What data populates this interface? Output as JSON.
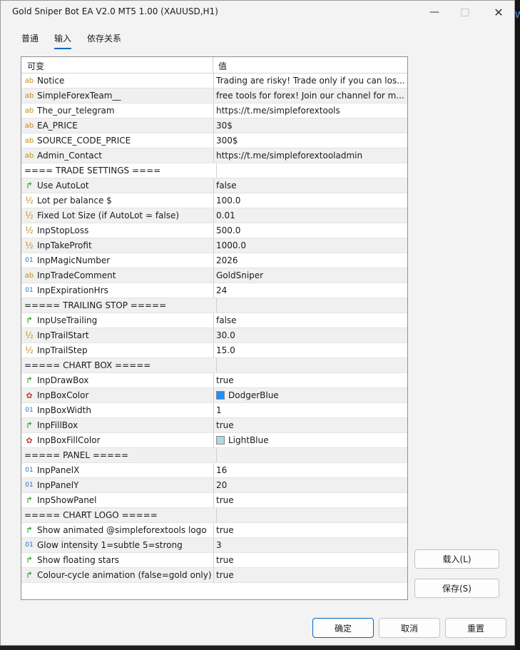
{
  "window": {
    "title": "Gold Sniper Bot EA V2.0 MT5 1.00 (XAUUSD,H1)",
    "minimize_icon": "minimize-icon",
    "maximize_icon": "maximize-icon",
    "close_icon": "close-icon"
  },
  "tabs": [
    {
      "label": "普通"
    },
    {
      "label": "输入",
      "active": true
    },
    {
      "label": "依存关系"
    }
  ],
  "grid": {
    "col_variable": "可变",
    "col_value": "值",
    "rows": [
      {
        "type": "string",
        "icon": "ab",
        "name": "Notice",
        "value": "Trading are risky! Trade only if you can los..."
      },
      {
        "type": "string",
        "icon": "ab",
        "name": "SimpleForexTeam__",
        "value": "free tools for forex! Join our channel for m..."
      },
      {
        "type": "string",
        "icon": "ab",
        "name": "The_our_telegram",
        "value": "https://t.me/simpleforextools"
      },
      {
        "type": "string",
        "icon": "ab",
        "name": "EA_PRICE",
        "value": "30$"
      },
      {
        "type": "string",
        "icon": "ab",
        "name": "SOURCE_CODE_PRICE",
        "value": "300$"
      },
      {
        "type": "string",
        "icon": "ab",
        "name": "Admin_Contact",
        "value": "https://t.me/simpleforextooladmin"
      },
      {
        "type": "separator",
        "name": "====  TRADE SETTINGS  ====",
        "value": ""
      },
      {
        "type": "bool",
        "icon": "↱",
        "name": "Use AutoLot",
        "value": "false"
      },
      {
        "type": "double",
        "icon": "½",
        "name": "Lot per balance $",
        "value": "100.0"
      },
      {
        "type": "double",
        "icon": "½",
        "name": "Fixed Lot Size (if AutoLot = false)",
        "value": "0.01"
      },
      {
        "type": "double",
        "icon": "½",
        "name": "InpStopLoss",
        "value": "500.0"
      },
      {
        "type": "double",
        "icon": "½",
        "name": "InpTakeProfit",
        "value": "1000.0"
      },
      {
        "type": "int",
        "icon": "01",
        "name": "InpMagicNumber",
        "value": "2026"
      },
      {
        "type": "string",
        "icon": "ab",
        "name": "InpTradeComment",
        "value": "GoldSniper"
      },
      {
        "type": "int",
        "icon": "01",
        "name": "InpExpirationHrs",
        "value": "24"
      },
      {
        "type": "separator",
        "name": "=====  TRAILING STOP  =====",
        "value": ""
      },
      {
        "type": "bool",
        "icon": "↱",
        "name": "InpUseTrailing",
        "value": "false"
      },
      {
        "type": "double",
        "icon": "½",
        "name": "InpTrailStart",
        "value": "30.0"
      },
      {
        "type": "double",
        "icon": "½",
        "name": "InpTrailStep",
        "value": "15.0"
      },
      {
        "type": "separator",
        "name": "=====  CHART BOX  =====",
        "value": ""
      },
      {
        "type": "bool",
        "icon": "↱",
        "name": "InpDrawBox",
        "value": "true"
      },
      {
        "type": "color",
        "icon": "✿",
        "name": "InpBoxColor",
        "value": "DodgerBlue",
        "swatch": "#1e90ff"
      },
      {
        "type": "int",
        "icon": "01",
        "name": "InpBoxWidth",
        "value": "1"
      },
      {
        "type": "bool",
        "icon": "↱",
        "name": "InpFillBox",
        "value": "true"
      },
      {
        "type": "color",
        "icon": "✿",
        "name": "InpBoxFillColor",
        "value": "LightBlue",
        "swatch": "#add8e6"
      },
      {
        "type": "separator",
        "name": "=====  PANEL  =====",
        "value": ""
      },
      {
        "type": "int",
        "icon": "01",
        "name": "InpPanelX",
        "value": "16"
      },
      {
        "type": "int",
        "icon": "01",
        "name": "InpPanelY",
        "value": "20"
      },
      {
        "type": "bool",
        "icon": "↱",
        "name": "InpShowPanel",
        "value": "true"
      },
      {
        "type": "separator",
        "name": "=====  CHART LOGO  =====",
        "value": ""
      },
      {
        "type": "bool",
        "icon": "↱",
        "name": "Show animated @simpleforextools logo",
        "value": "true"
      },
      {
        "type": "int",
        "icon": "01",
        "name": "Glow intensity  1=subtle  5=strong",
        "value": "3"
      },
      {
        "type": "bool",
        "icon": "↱",
        "name": "Show floating stars",
        "value": "true"
      },
      {
        "type": "bool",
        "icon": "↱",
        "name": "Colour-cycle animation (false=gold only)",
        "value": "true"
      }
    ]
  },
  "side_buttons": {
    "load": "载入(L)",
    "save": "保存(S)"
  },
  "bottom_buttons": {
    "ok": "确定",
    "cancel": "取消",
    "reset": "重置"
  },
  "background": {
    "edge_text": "W"
  },
  "colors": {
    "accent": "#0067c0",
    "window_bg": "#f3f3f3",
    "alt_row": "#f0f0f0"
  }
}
